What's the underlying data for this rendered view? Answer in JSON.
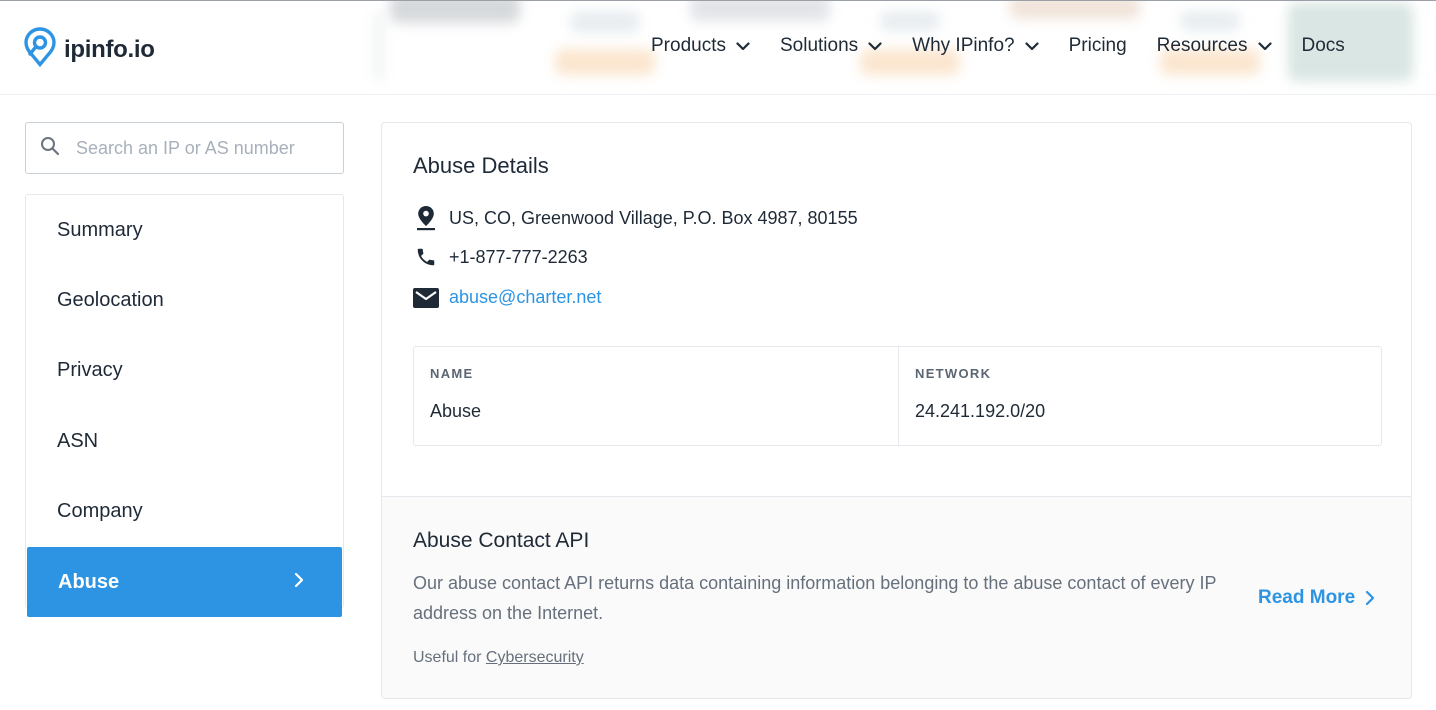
{
  "header": {
    "logo_text": "ipinfo.io",
    "logo_icon": "location-pin-logo",
    "nav": [
      {
        "label": "Products",
        "has_dropdown": true
      },
      {
        "label": "Solutions",
        "has_dropdown": true
      },
      {
        "label": "Why IPinfo?",
        "has_dropdown": true
      },
      {
        "label": "Pricing",
        "has_dropdown": false
      },
      {
        "label": "Resources",
        "has_dropdown": true
      },
      {
        "label": "Docs",
        "has_dropdown": false
      }
    ]
  },
  "search": {
    "placeholder": "Search an IP or AS number",
    "value": ""
  },
  "sidebar": {
    "items": [
      {
        "label": "Summary"
      },
      {
        "label": "Geolocation"
      },
      {
        "label": "Privacy"
      },
      {
        "label": "ASN"
      },
      {
        "label": "Company"
      },
      {
        "label": "Abuse",
        "active": true
      }
    ]
  },
  "abuse": {
    "title": "Abuse Details",
    "address": "US, CO, Greenwood Village, P.O. Box 4987, 80155",
    "phone": "+1-877-777-2263",
    "email": "abuse@charter.net",
    "table": {
      "headers": [
        "NAME",
        "NETWORK"
      ],
      "row": [
        "Abuse",
        "24.241.192.0/20"
      ]
    }
  },
  "api": {
    "title": "Abuse Contact API",
    "description": "Our abuse contact API returns data containing information belonging to the abuse contact of every IP address on the Internet.",
    "read_more": "Read More",
    "useful_prefix": "Useful for",
    "useful_link": "Cybersecurity"
  },
  "colors": {
    "accent": "#2d94e3",
    "text": "#1f2a37",
    "muted": "#66707c",
    "border": "#e5e8ec"
  }
}
